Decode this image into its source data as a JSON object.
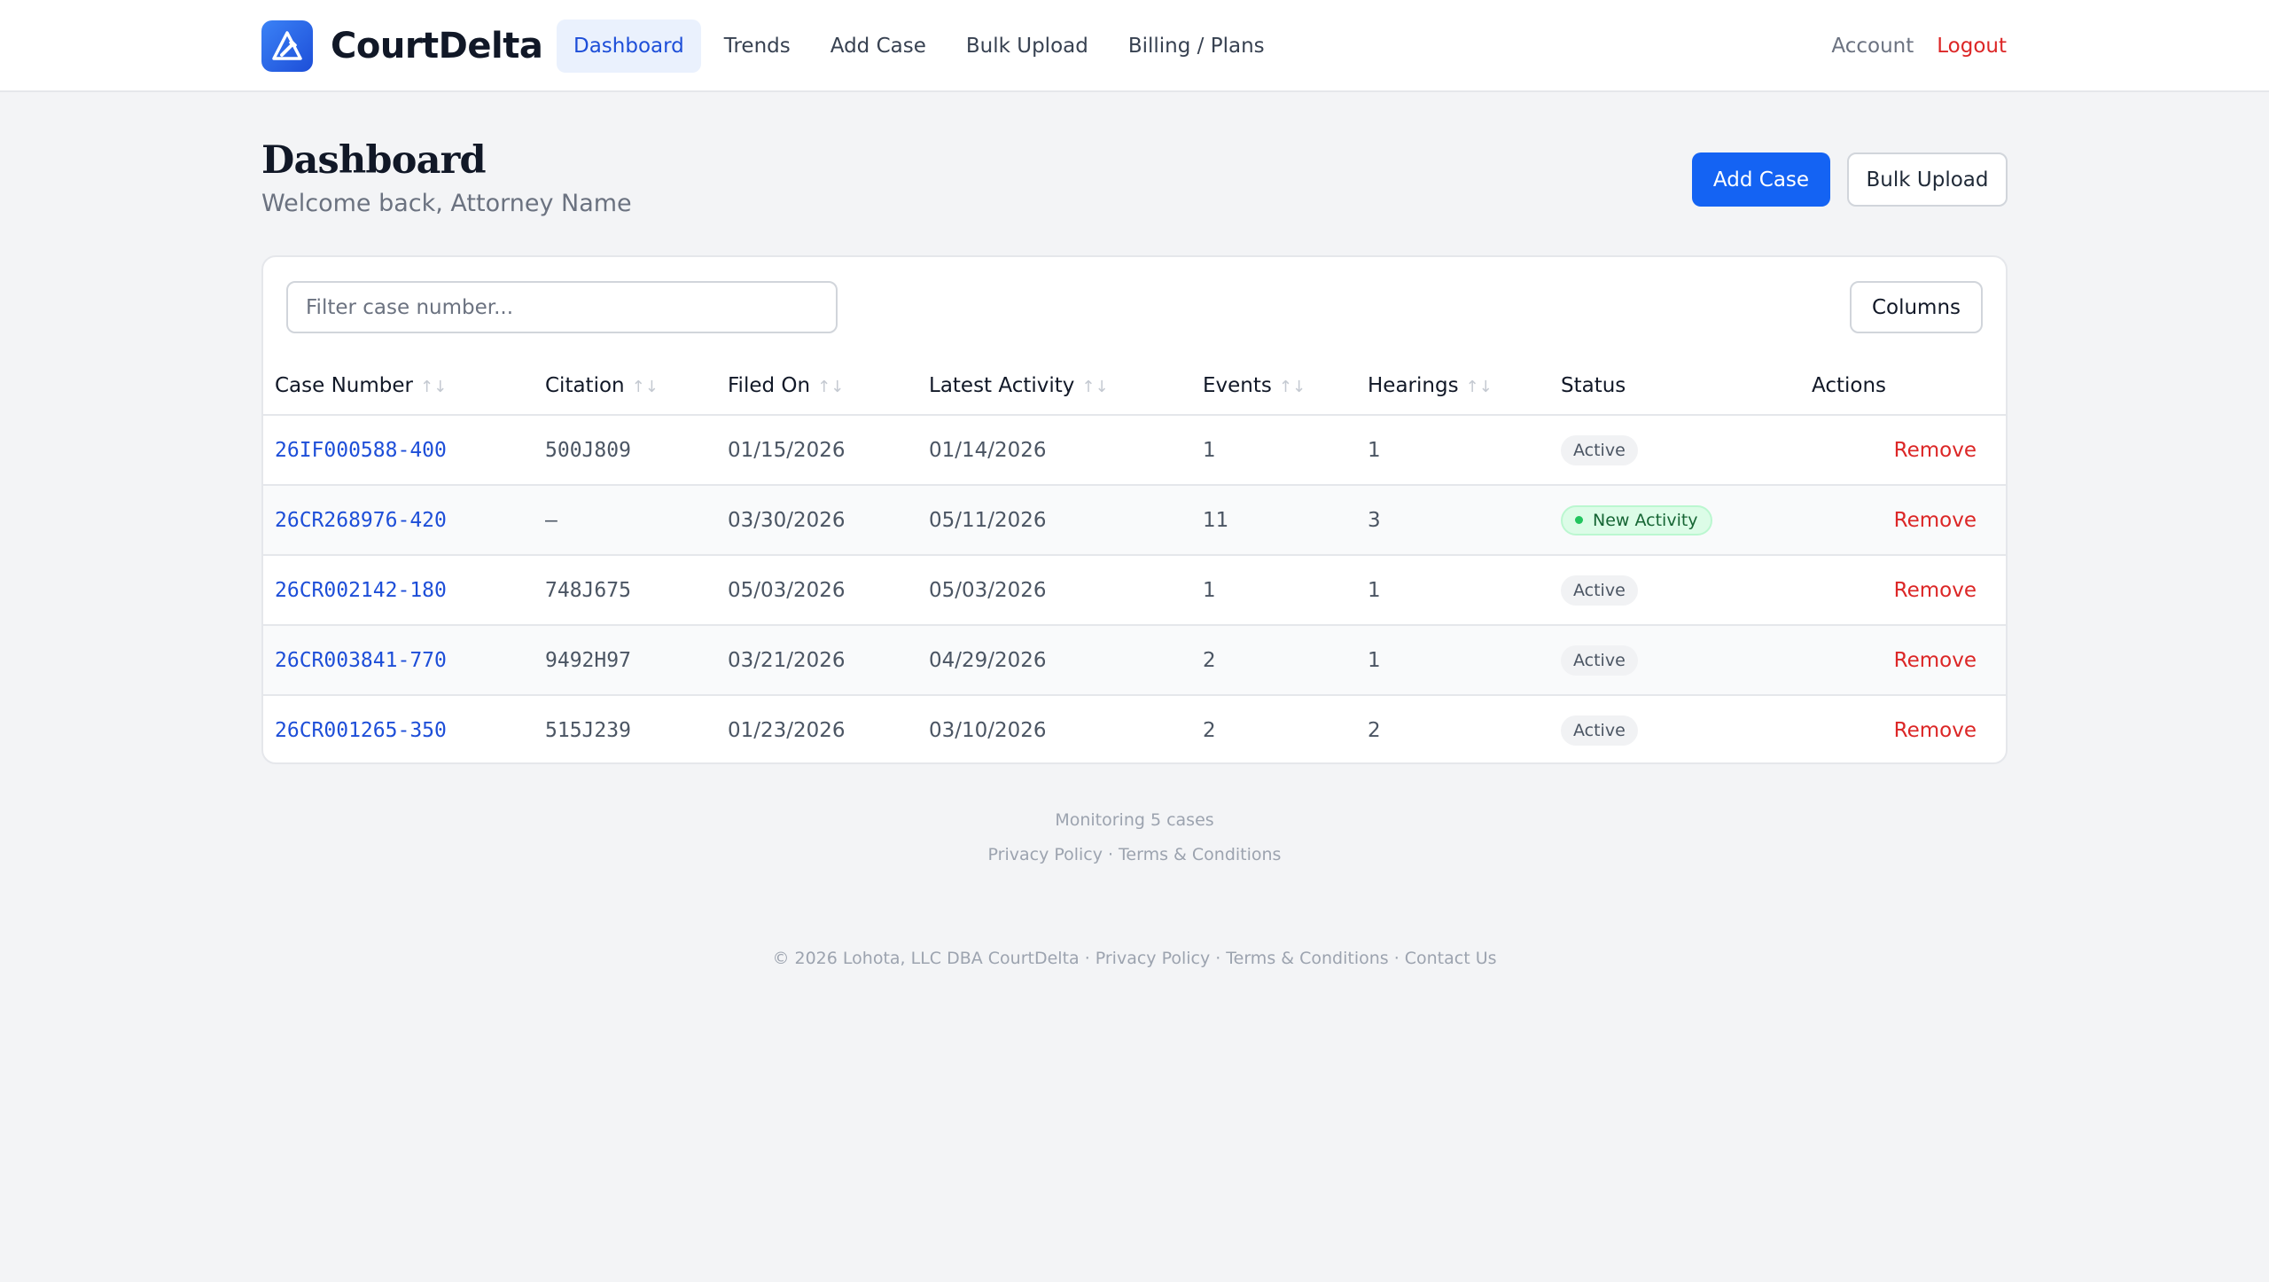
{
  "brand": {
    "name": "CourtDelta",
    "accent": "#1463f3"
  },
  "nav": {
    "items": [
      {
        "label": "Dashboard",
        "active": true
      },
      {
        "label": "Trends",
        "active": false
      },
      {
        "label": "Add Case",
        "active": false
      },
      {
        "label": "Bulk Upload",
        "active": false
      },
      {
        "label": "Billing / Plans",
        "active": false
      }
    ],
    "account": "Account",
    "logout": "Logout"
  },
  "header": {
    "title": "Dashboard",
    "subtitle": "Welcome back, Attorney Name",
    "add_case_label": "Add Case",
    "bulk_upload_label": "Bulk Upload"
  },
  "table": {
    "filter_placeholder": "Filter case number...",
    "columns_button": "Columns",
    "headers": [
      "Case Number",
      "Citation",
      "Filed On",
      "Latest Activity",
      "Events",
      "Hearings",
      "Status",
      "Actions"
    ],
    "sort_glyph": "↑↓",
    "rows": [
      {
        "case_number": "26IF000588-400",
        "citation": "500J809",
        "filed_on": "01/15/2026",
        "latest_activity": "01/14/2026",
        "events": "1",
        "hearings": "1",
        "status": "Active",
        "action": "Remove"
      },
      {
        "case_number": "26CR268976-420",
        "citation": "—",
        "filed_on": "03/30/2026",
        "latest_activity": "05/11/2026",
        "events": "11",
        "hearings": "3",
        "status": "New Activity",
        "action": "Remove"
      },
      {
        "case_number": "26CR002142-180",
        "citation": "748J675",
        "filed_on": "05/03/2026",
        "latest_activity": "05/03/2026",
        "events": "1",
        "hearings": "1",
        "status": "Active",
        "action": "Remove"
      },
      {
        "case_number": "26CR003841-770",
        "citation": "9492H97",
        "filed_on": "03/21/2026",
        "latest_activity": "04/29/2026",
        "events": "2",
        "hearings": "1",
        "status": "Active",
        "action": "Remove"
      },
      {
        "case_number": "26CR001265-350",
        "citation": "515J239",
        "filed_on": "01/23/2026",
        "latest_activity": "03/10/2026",
        "events": "2",
        "hearings": "2",
        "status": "Active",
        "action": "Remove"
      }
    ]
  },
  "footer": {
    "monitoring": "Monitoring 5 cases",
    "privacy": "Privacy Policy",
    "terms": "Terms & Conditions",
    "separator": "·",
    "copyright": "© 2026 Lohota, LLC DBA CourtDelta",
    "contact": "Contact Us"
  }
}
